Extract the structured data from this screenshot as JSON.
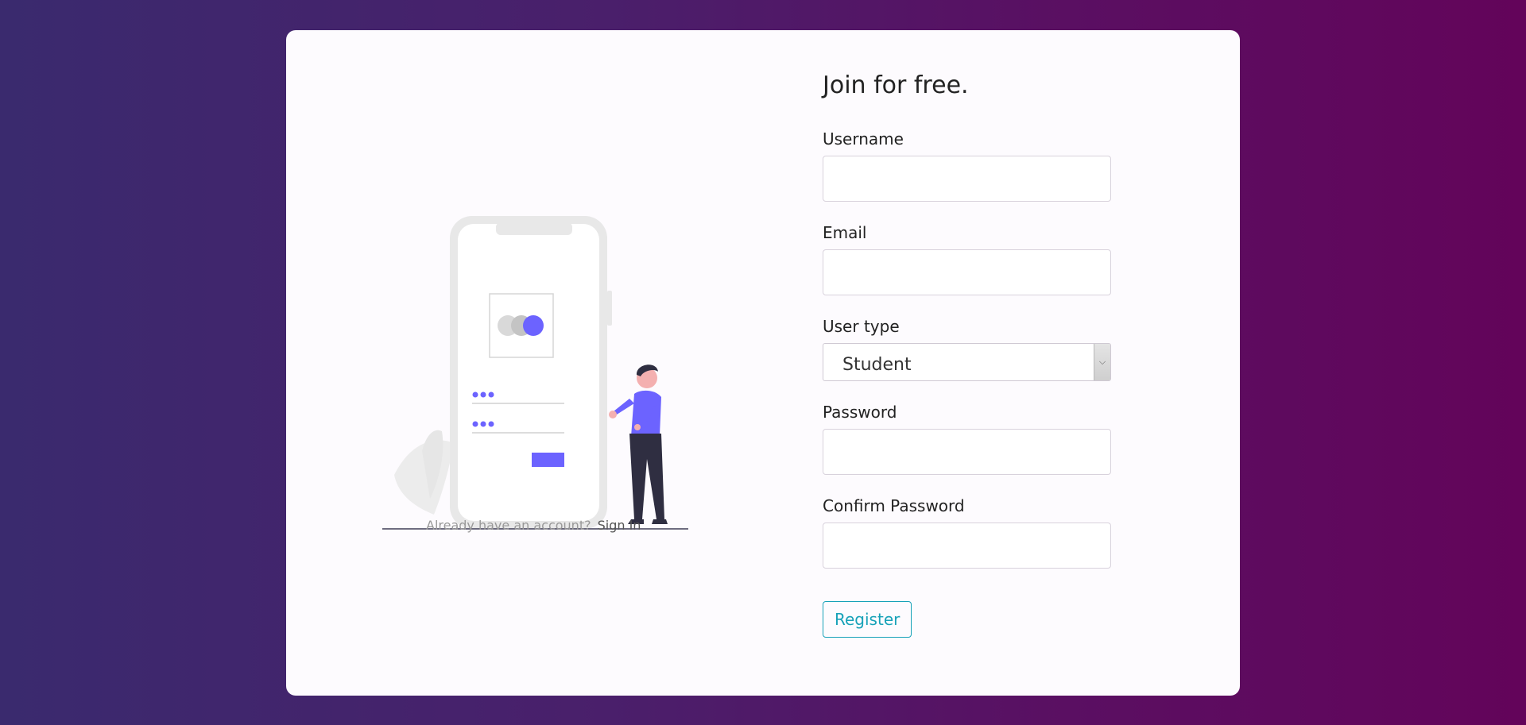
{
  "signin": {
    "prompt": "Already have an account?",
    "link_label": "Sign In"
  },
  "form": {
    "title": "Join for free.",
    "username_label": "Username",
    "username_value": "",
    "email_label": "Email",
    "email_value": "",
    "user_type_label": "User type",
    "user_type_value": "Student",
    "password_label": "Password",
    "password_value": "",
    "confirm_password_label": "Confirm Password",
    "confirm_password_value": "",
    "register_label": "Register"
  },
  "colors": {
    "accent": "#6c63ff",
    "button": "#17a2b8",
    "background_start": "#3a2a6e",
    "background_end": "#63045a"
  },
  "icons": {
    "dropdown": "chevron-down-icon"
  }
}
